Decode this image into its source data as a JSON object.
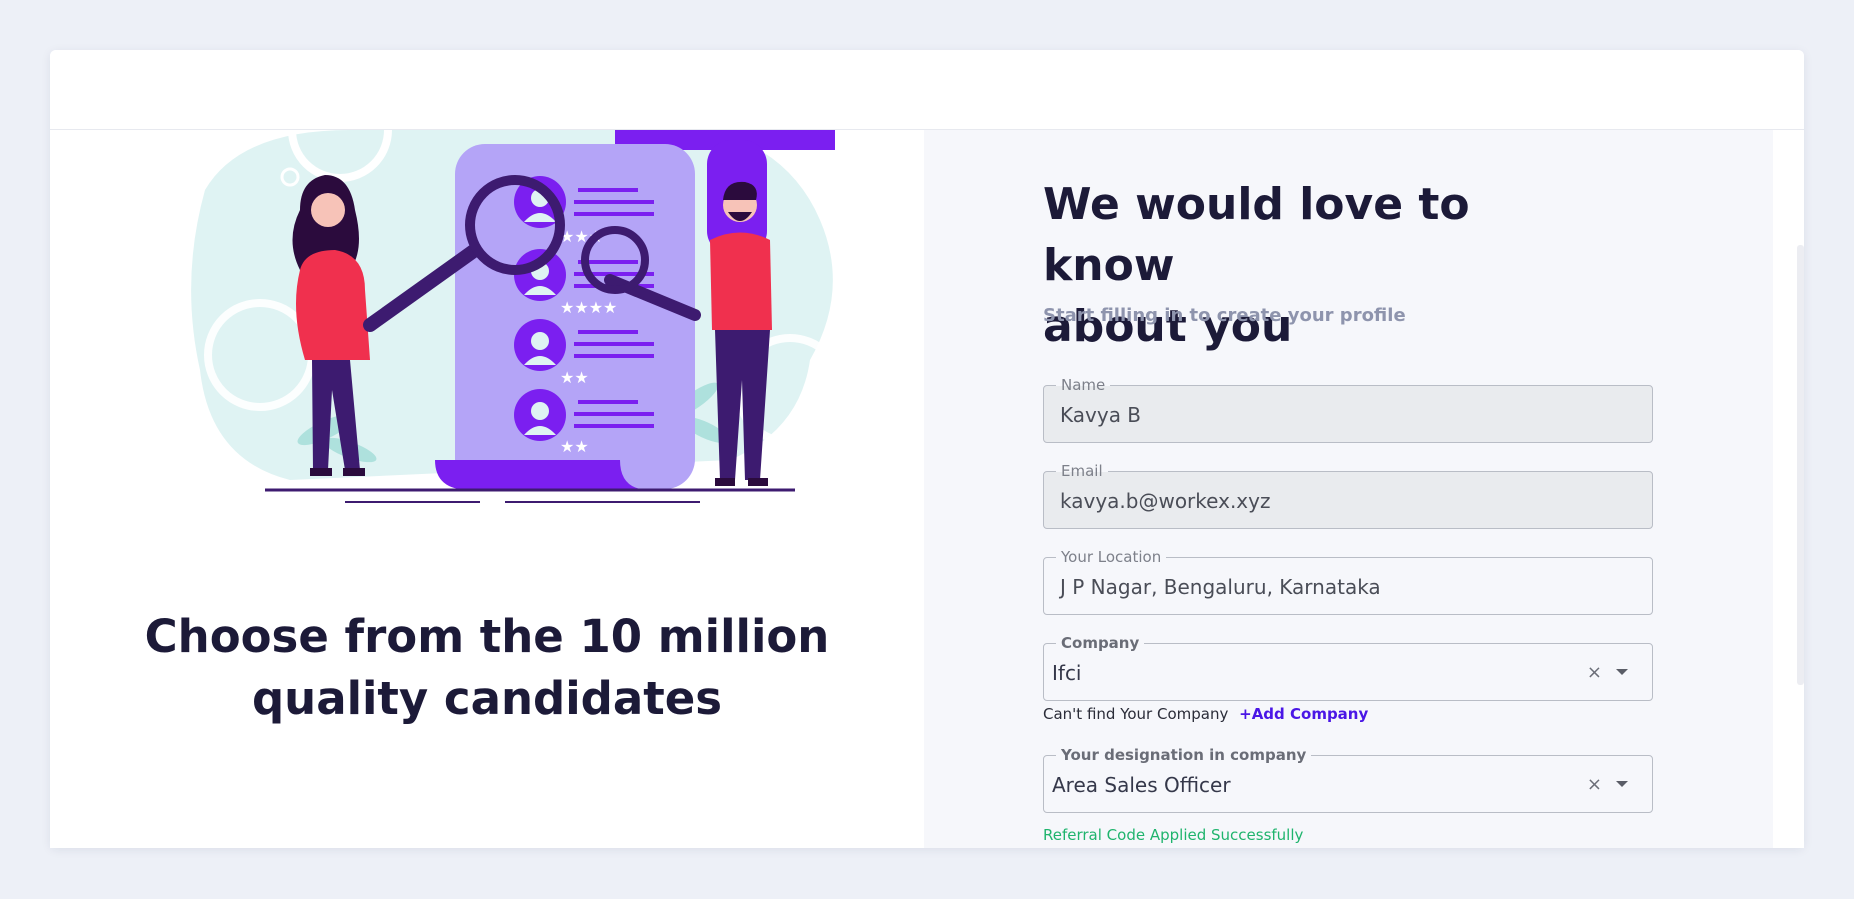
{
  "left": {
    "tagline_line1": "Choose from the 10 million",
    "tagline_line2": "quality candidates"
  },
  "form": {
    "heading_line1": "We would love to know",
    "heading_line2": "about you",
    "subheading": "Start filling in to create your profile",
    "name": {
      "label": "Name",
      "value": "Kavya B"
    },
    "email": {
      "label": "Email",
      "value": "kavya.b@workex.xyz"
    },
    "location": {
      "label": "Your Location",
      "value": "J P Nagar, Bengaluru, Karnataka"
    },
    "company": {
      "label": "Company",
      "value": "Ifci",
      "clear": "×"
    },
    "company_helper": {
      "text": "Can't find Your Company",
      "link": "+Add Company"
    },
    "designation": {
      "label": "Your designation in company",
      "value": "Area Sales Officer",
      "clear": "×"
    },
    "referral_status": "Referral Code Applied Successfully"
  },
  "colors": {
    "accent": "#4a16e6",
    "illustration_purple": "#7b1ff0",
    "illustration_lavender": "#b4a4f7",
    "illustration_red": "#f0304e",
    "illustration_mint": "#dff3f3",
    "success": "#1fb46d"
  }
}
